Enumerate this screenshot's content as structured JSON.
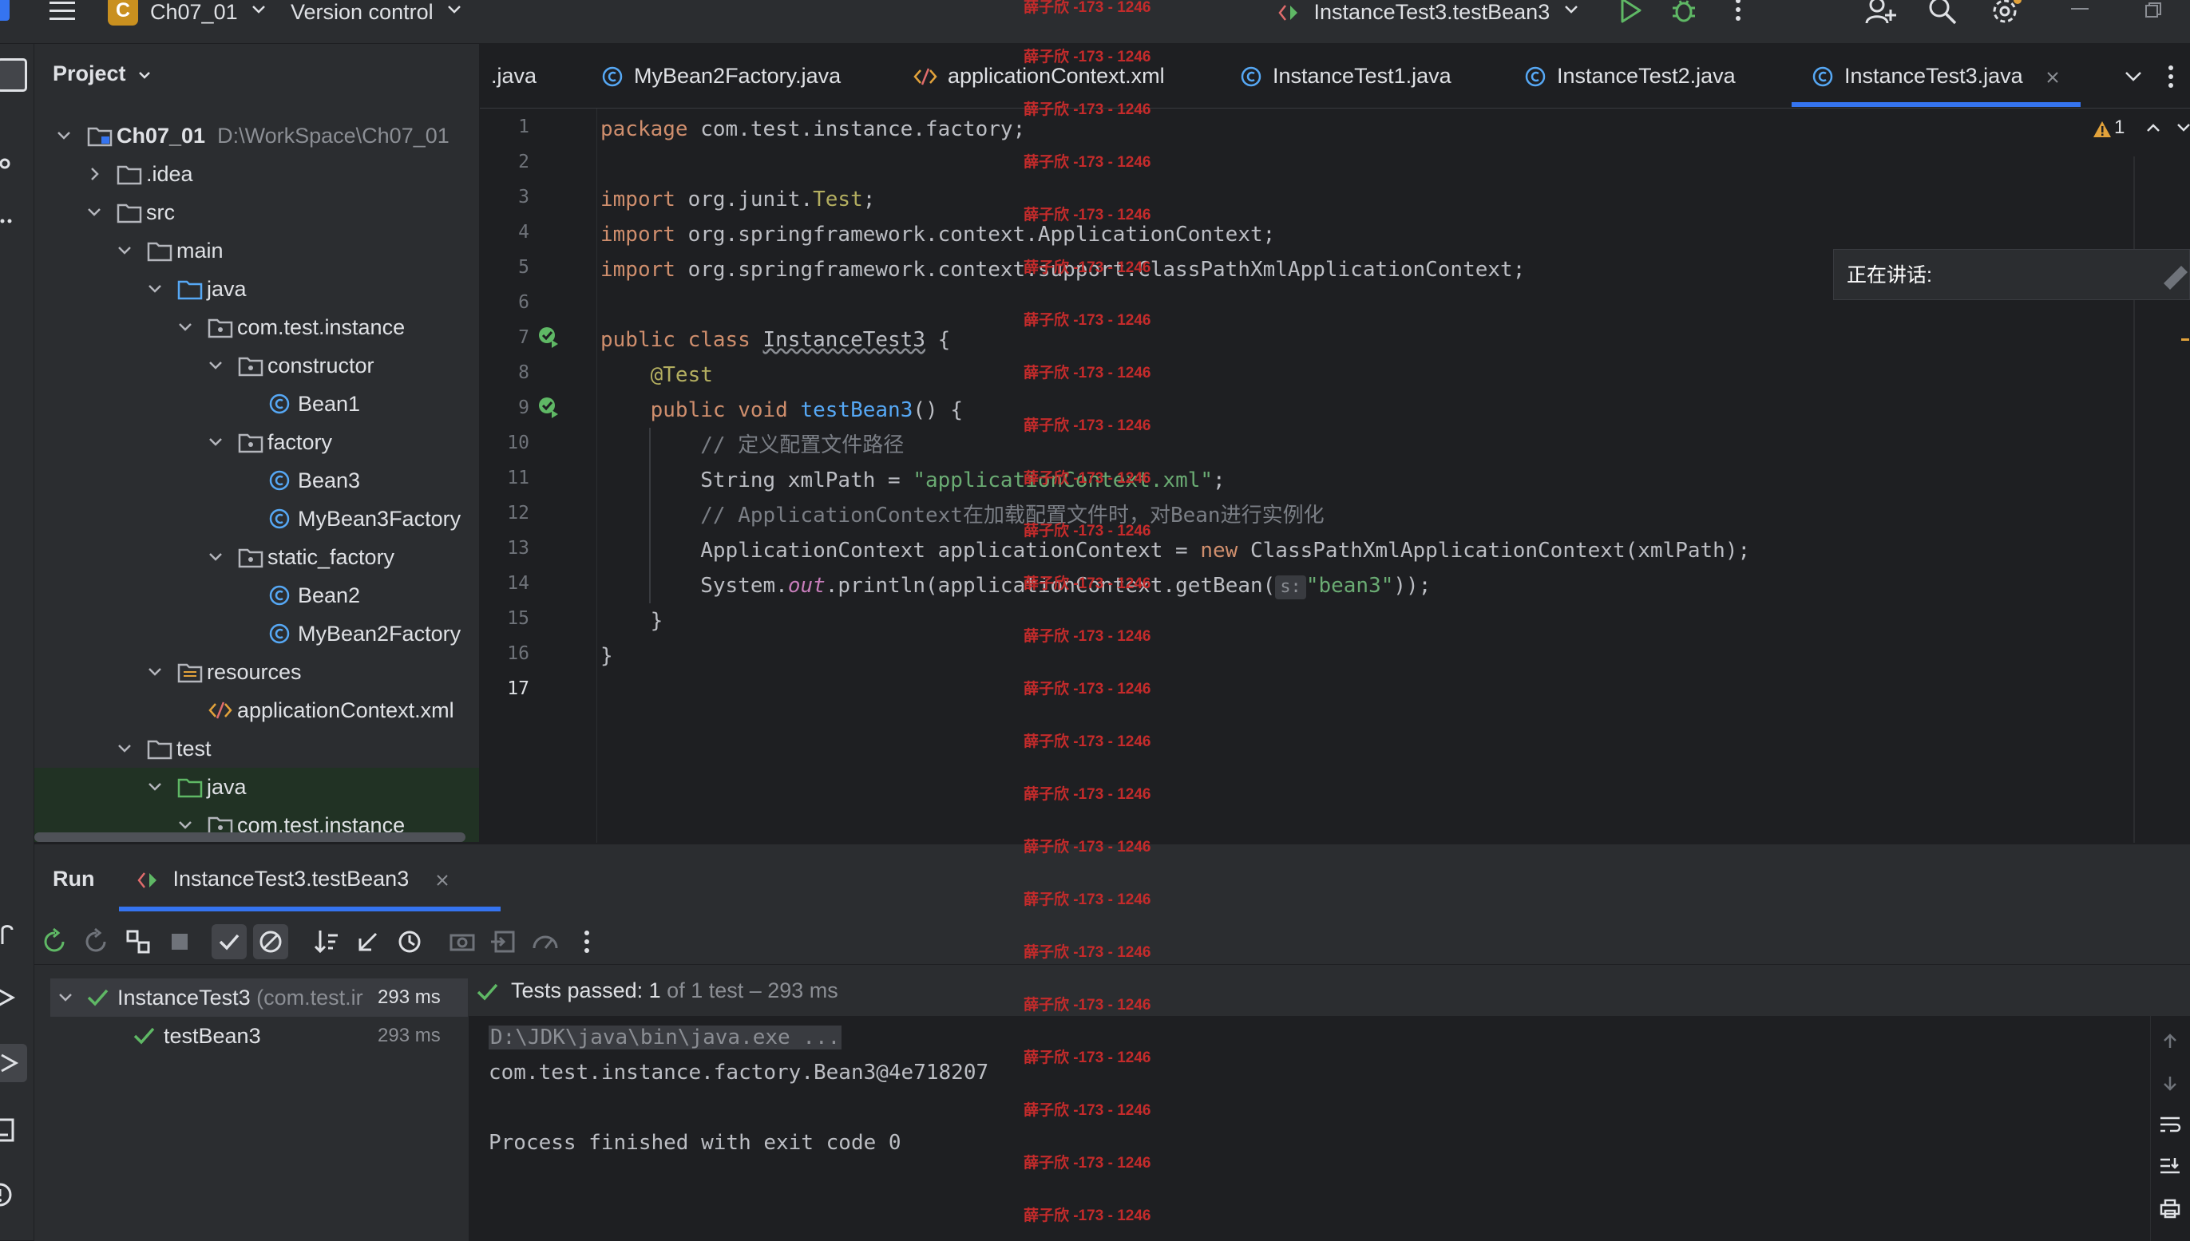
{
  "topbar": {
    "project_badge": "C",
    "project_name": "Ch07_01",
    "version_control": "Version control",
    "run_config": "InstanceTest3.testBean3"
  },
  "project_panel": {
    "title": "Project",
    "root": {
      "label": "Ch07_01",
      "path": "D:\\WorkSpace\\Ch07_01"
    },
    "items": [
      {
        "label": ".idea"
      },
      {
        "label": "src"
      },
      {
        "label": "main"
      },
      {
        "label": "java"
      },
      {
        "label": "com.test.instance"
      },
      {
        "label": "constructor"
      },
      {
        "label": "Bean1"
      },
      {
        "label": "factory"
      },
      {
        "label": "Bean3"
      },
      {
        "label": "MyBean3Factory"
      },
      {
        "label": "static_factory"
      },
      {
        "label": "Bean2"
      },
      {
        "label": "MyBean2Factory"
      },
      {
        "label": "resources"
      },
      {
        "label": "applicationContext.xml"
      },
      {
        "label": "test"
      },
      {
        "label": "java"
      },
      {
        "label": "com.test.instance"
      }
    ]
  },
  "editor_tabs": [
    {
      "label": ".java"
    },
    {
      "label": "MyBean2Factory.java"
    },
    {
      "label": "applicationContext.xml"
    },
    {
      "label": "InstanceTest1.java"
    },
    {
      "label": "InstanceTest2.java"
    },
    {
      "label": "InstanceTest3.java"
    }
  ],
  "warnings_count": "1",
  "line_numbers": [
    "1",
    "2",
    "3",
    "4",
    "5",
    "6",
    "7",
    "8",
    "9",
    "10",
    "11",
    "12",
    "13",
    "14",
    "15",
    "16",
    "17"
  ],
  "code": {
    "l1_kw": "package",
    "l1_rest": " com.test.instance.factory;",
    "l3_kw": "import",
    "l3_a": " org.junit.",
    "l3_b": "Test",
    "l3_c": ";",
    "l4_kw": "import",
    "l4_rest": " org.springframework.context.ApplicationContext;",
    "l5_kw": "import",
    "l5_rest": " org.springframework.context.support.ClassPathXmlApplicationContext;",
    "l7_kw": "public class",
    "l7_name": "InstanceTest3",
    "l7_rest": " {",
    "l8_ann": "@Test",
    "l9_kw": "public void",
    "l9_fn": "testBean3",
    "l9_rest": "() {",
    "l10": "// 定义配置文件路径",
    "l11_a": "String xmlPath = ",
    "l11_str": "\"applicationContext.xml\"",
    "l11_b": ";",
    "l12": "// ApplicationContext在加载配置文件时，对Bean进行实例化",
    "l13_a": "ApplicationContext applicationContext = ",
    "l13_kw": "new",
    "l13_b": " ClassPathXmlApplicationContext(xmlPath);",
    "l14_a": "System.",
    "l14_out": "out",
    "l14_b": ".println(applicationContext.getBean(",
    "l14_hint": "s:",
    "l14_str": "\"bean3\"",
    "l14_c": "));",
    "l15": "}",
    "l16": "}"
  },
  "watermark": "薛子欣 -173 - 1246",
  "speaking_label": "正在讲话:",
  "run_panel": {
    "title": "Run",
    "tab_label": "InstanceTest3.testBean3",
    "tests": [
      {
        "name": "InstanceTest3",
        "detail": "(com.test.ir",
        "time": "293 ms"
      },
      {
        "name": "testBean3",
        "detail": "",
        "time": "293 ms"
      }
    ],
    "status_prefix": "Tests passed:",
    "status_count": "1",
    "status_suffix": "of 1 test – 293 ms",
    "console": [
      "D:\\JDK\\java\\bin\\java.exe ...",
      "com.test.instance.factory.Bean3@4e718207",
      "",
      "Process finished with exit code 0"
    ]
  },
  "colors": {
    "background": "#1e1f22",
    "panel": "#2b2d30",
    "accent": "#3574f0",
    "keyword": "#cf8e6d",
    "string": "#6aab73",
    "function": "#56a8f5",
    "success": "#5fb865",
    "watermark": "#c42b2b"
  }
}
